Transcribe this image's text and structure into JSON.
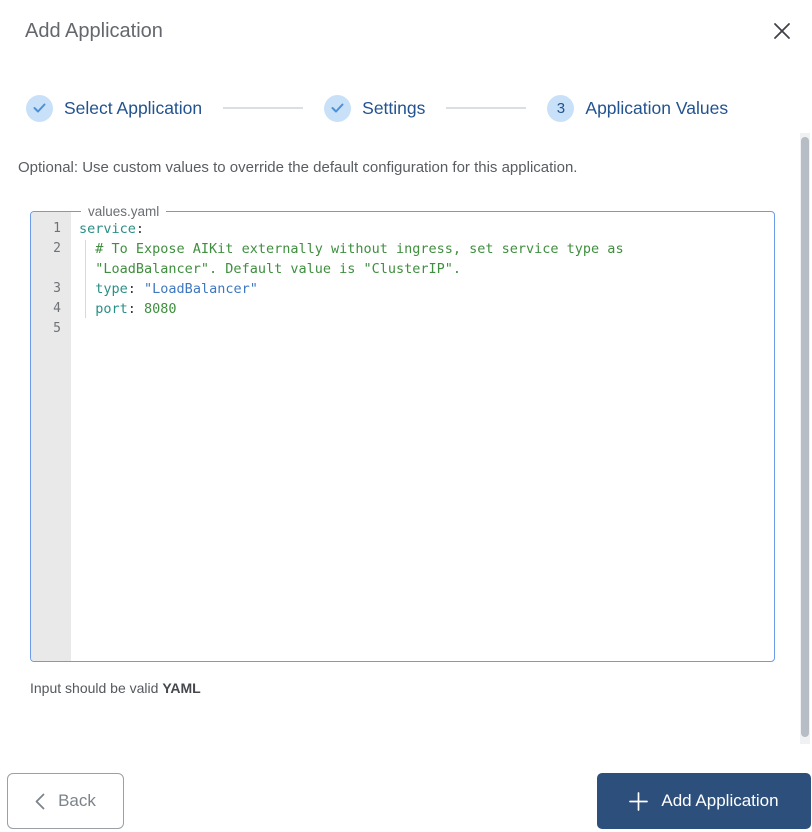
{
  "dialog": {
    "title": "Add Application"
  },
  "stepper": {
    "steps": [
      {
        "label": "Select Application",
        "status": "done"
      },
      {
        "label": "Settings",
        "status": "done"
      },
      {
        "label": "Application Values",
        "status": "active",
        "number": "3"
      }
    ]
  },
  "description": "Optional: Use custom values to override the default configuration for this application.",
  "editor": {
    "filename": "values.yaml",
    "rows": [
      {
        "line": "1",
        "tokens": [
          [
            "service",
            "key"
          ],
          [
            ":",
            "punct"
          ]
        ]
      },
      {
        "line": "2",
        "tokens": [
          [
            "  ",
            "plain"
          ],
          [
            "# To Expose AIKit externally without ingress, set service type as",
            "comment"
          ]
        ]
      },
      {
        "line": "",
        "tokens": [
          [
            "  ",
            "plain"
          ],
          [
            "\"LoadBalancer\". Default value is \"ClusterIP\".",
            "comment"
          ]
        ]
      },
      {
        "line": "3",
        "tokens": [
          [
            "  ",
            "plain"
          ],
          [
            "type",
            "key"
          ],
          [
            ": ",
            "punct"
          ],
          [
            "\"LoadBalancer\"",
            "string"
          ]
        ]
      },
      {
        "line": "4",
        "tokens": [
          [
            "  ",
            "plain"
          ],
          [
            "port",
            "key"
          ],
          [
            ": ",
            "punct"
          ],
          [
            "8080",
            "number"
          ]
        ]
      },
      {
        "line": "5",
        "tokens": []
      }
    ],
    "hint_prefix": "Input should be valid ",
    "hint_emphasis": "YAML"
  },
  "footer": {
    "back_label": "Back",
    "submit_label": "Add Application"
  },
  "colors": {
    "accent_blue": "#2d4f7c",
    "step_circle": "#c8e1f8",
    "step_label": "#23538f",
    "check_blue": "#4b91d8",
    "editor_border": "#6c9ce8",
    "code_key": "#2a8f85",
    "code_comment": "#3f8f3f",
    "code_string": "#3e78c0",
    "code_number": "#3f8f3f"
  }
}
